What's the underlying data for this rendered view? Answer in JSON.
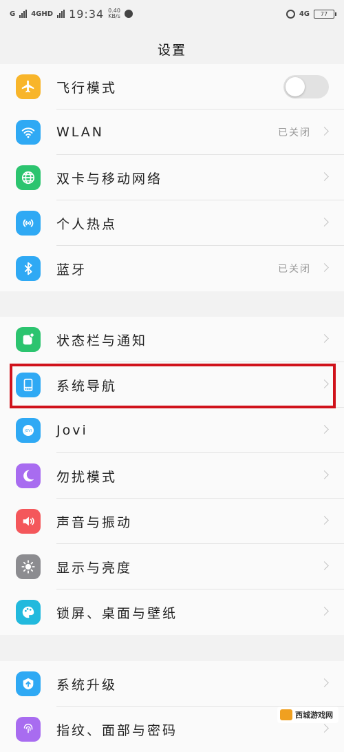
{
  "statusbar": {
    "carrier": "G",
    "network": "4GHD",
    "time": "19:34",
    "speed_value": "0.40",
    "speed_unit": "KB/s",
    "network2": "4G",
    "battery": "77"
  },
  "header": {
    "title": "设置"
  },
  "groups": [
    {
      "items": [
        {
          "name": "airplane",
          "label": "飞行模式",
          "icon": "airplane-icon",
          "color": "#f8b52a",
          "control": "toggle",
          "toggle_on": false
        },
        {
          "name": "wlan",
          "label": "WLAN",
          "icon": "wifi-icon",
          "color": "#2fa9f4",
          "value": "已关闭",
          "control": "chevron"
        },
        {
          "name": "dual-sim",
          "label": "双卡与移动网络",
          "icon": "globe-icon",
          "color": "#2cc46f",
          "control": "chevron"
        },
        {
          "name": "hotspot",
          "label": "个人热点",
          "icon": "hotspot-icon",
          "color": "#2fa9f4",
          "control": "chevron"
        },
        {
          "name": "bluetooth",
          "label": "蓝牙",
          "icon": "bluetooth-icon",
          "color": "#2fa9f4",
          "value": "已关闭",
          "control": "chevron"
        }
      ]
    },
    {
      "items": [
        {
          "name": "statusbar-notify",
          "label": "状态栏与通知",
          "icon": "notification-icon",
          "color": "#2cc46f",
          "control": "chevron"
        },
        {
          "name": "system-nav",
          "label": "系统导航",
          "icon": "navigation-icon",
          "color": "#2fa9f4",
          "control": "chevron",
          "highlighted": true
        },
        {
          "name": "jovi",
          "label": "Jovi",
          "icon": "jovi-icon",
          "color": "#2fa9f4",
          "control": "chevron"
        },
        {
          "name": "dnd",
          "label": "勿扰模式",
          "icon": "moon-icon",
          "color": "#a86cf0",
          "control": "chevron"
        },
        {
          "name": "sound",
          "label": "声音与振动",
          "icon": "speaker-icon",
          "color": "#f4575b",
          "control": "chevron"
        },
        {
          "name": "display",
          "label": "显示与亮度",
          "icon": "sun-icon",
          "color": "#8c8c90",
          "control": "chevron"
        },
        {
          "name": "wallpaper",
          "label": "锁屏、桌面与壁纸",
          "icon": "palette-icon",
          "color": "#22b9dd",
          "control": "chevron"
        }
      ]
    },
    {
      "items": [
        {
          "name": "system-update",
          "label": "系统升级",
          "icon": "update-icon",
          "color": "#2fa9f4",
          "control": "chevron"
        },
        {
          "name": "fingerprint",
          "label": "指纹、面部与密码",
          "icon": "fingerprint-icon",
          "color": "#a86cf0",
          "control": "chevron"
        }
      ]
    }
  ],
  "watermark": {
    "text": "西城游戏网"
  }
}
